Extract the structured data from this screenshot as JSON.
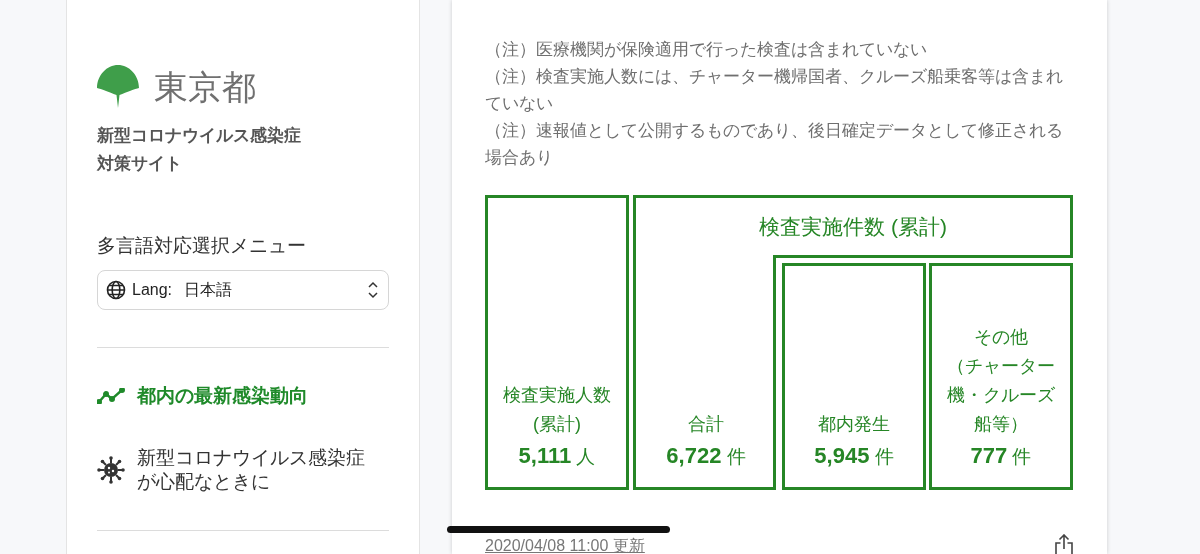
{
  "sidebar": {
    "logo_text": "東京都",
    "site_title_lines": [
      "新型コロナウイルス感染症",
      "対策サイト"
    ],
    "language_menu": {
      "label": "多言語対応選択メニュー",
      "prefix": "Lang:",
      "value": "日本語"
    },
    "nav_items": [
      {
        "label": "都内の最新感染動向",
        "kind": "trend",
        "selected": true
      },
      {
        "label": "新型コロナウイルス感染症が心配なときに",
        "kind": "virus",
        "selected": false
      }
    ]
  },
  "card": {
    "notes": [
      "（注）医療機関が保険適用で行った検査は含まれていない",
      "（注）検査実施人数には、チャーター機帰国者、クルーズ船乗客等は含まれていない",
      "（注）速報値として公開するものであり、後日確定データとして修正される場合あり"
    ],
    "people_box": {
      "label_lines": [
        "検査実施人数",
        "(累計)"
      ],
      "value": "5,111",
      "unit": "人"
    },
    "tests_header": "検査実施件数 (累計)",
    "total_box": {
      "label_lines": [
        "合計"
      ],
      "value": "6,722",
      "unit": "件"
    },
    "breakdown": [
      {
        "label_lines": [
          "都内発生"
        ],
        "value": "5,945",
        "unit": "件"
      },
      {
        "label_lines": [
          "その他",
          "（チャーター",
          "機・クルーズ",
          "船等）"
        ],
        "value": "777",
        "unit": "件"
      }
    ],
    "updated": "2020/04/08 11:00 更新"
  }
}
